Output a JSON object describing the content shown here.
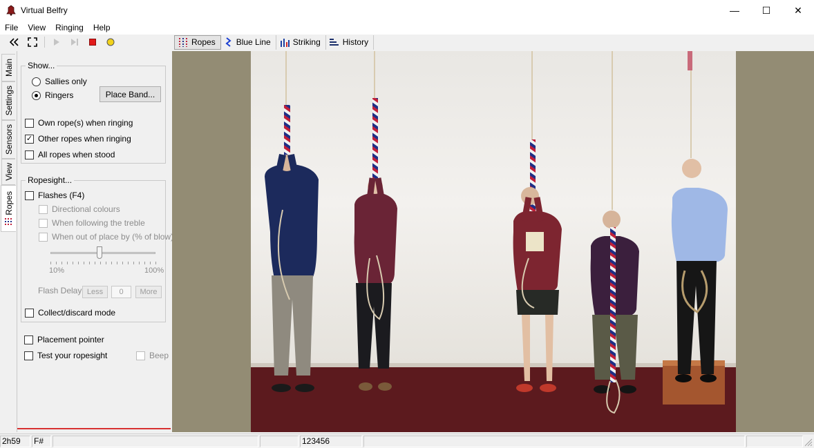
{
  "window": {
    "title": "Virtual Belfry",
    "minimize": "—",
    "maximize": "☐",
    "close": "✕"
  },
  "menu": [
    "File",
    "View",
    "Ringing",
    "Help"
  ],
  "toolbar": {
    "tabs": [
      {
        "label": "Ropes",
        "icon": "ropes-icon",
        "active": true
      },
      {
        "label": "Blue Line",
        "icon": "blue-line-icon",
        "active": false
      },
      {
        "label": "Striking",
        "icon": "striking-icon",
        "active": false
      },
      {
        "label": "History",
        "icon": "history-icon",
        "active": false
      }
    ]
  },
  "side_tabs": [
    "Main",
    "Settings",
    "Sensors",
    "View",
    "Ropes"
  ],
  "panel": {
    "show": {
      "title": "Show...",
      "sallies_only": "Sallies only",
      "ringers": "Ringers",
      "place_band": "Place Band...",
      "own_ropes": "Own rope(s) when ringing",
      "other_ropes": "Other ropes when ringing",
      "all_ropes": "All ropes when stood"
    },
    "ropesight": {
      "title": "Ropesight...",
      "flashes": "Flashes (F4)",
      "directional": "Directional colours",
      "following_treble": "When following the treble",
      "out_of_place": "When out of place by (% of blow):",
      "slider_min": "10%",
      "slider_max": "100%",
      "slider_level_fraction": 0.47,
      "flash_delay": "Flash Delay",
      "less": "Less",
      "delay_value": "0",
      "more": "More",
      "collect_discard": "Collect/discard mode"
    },
    "placement_pointer": "Placement pointer",
    "test_ropesight": "Test your ropesight",
    "beep": "Beep"
  },
  "status": {
    "time": "2h59",
    "key": "F#",
    "ringing": "123456"
  },
  "colors": {
    "accent_red": "#d73030",
    "sally_red": "#c0203a",
    "sally_blue": "#1f2f86",
    "sally_white": "#f2f2f2"
  }
}
